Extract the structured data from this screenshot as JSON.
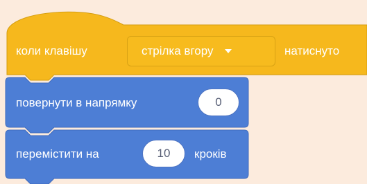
{
  "hat_block": {
    "label_before": "коли клавішу",
    "key_dropdown": "стрілка вгору",
    "label_after": "натиснуто",
    "color": "#ffbf1a"
  },
  "point_block": {
    "label": "повернути в напрямку",
    "direction_value": "0",
    "color": "#4c97ff"
  },
  "move_block": {
    "label_before": "перемістити на",
    "steps_value": "10",
    "label_after": "кроків",
    "color": "#4c97ff"
  }
}
